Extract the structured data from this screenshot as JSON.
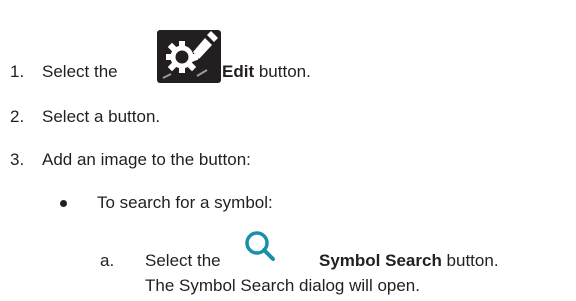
{
  "steps": [
    {
      "number": "1.",
      "text_before": "Select the",
      "bold": "Edit",
      "text_after": " button.",
      "icon": "edit-gear-pencil-icon"
    },
    {
      "number": "2.",
      "text": "Select a button."
    },
    {
      "number": "3.",
      "text": "Add an image to the button:"
    }
  ],
  "bullets": [
    {
      "text": "To search for a symbol:"
    }
  ],
  "substeps": [
    {
      "letter": "a.",
      "text_before": "Select the",
      "bold": "Symbol Search",
      "text_after": " button.",
      "continuation": "The Symbol Search dialog will open.",
      "icon": "search-magnifier-icon"
    }
  ],
  "colors": {
    "text": "#231f20",
    "search_icon": "#1a8fa8"
  }
}
